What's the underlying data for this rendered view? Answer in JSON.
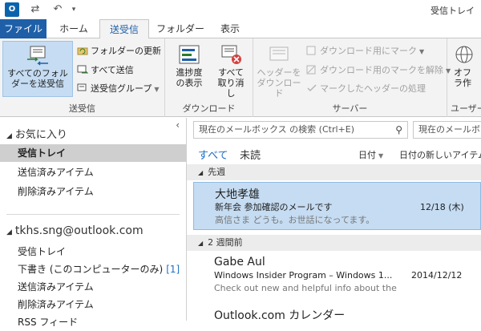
{
  "window": {
    "title": "受信トレイ"
  },
  "tabs": [
    "ファイル",
    "ホーム",
    "送受信",
    "フォルダー",
    "表示"
  ],
  "ribbon": {
    "send_all": "すべてのフォルダーを送受信",
    "update_folder": "フォルダーの更新",
    "send_all_small": "すべて送信",
    "send_receive_groups": "送受信グループ",
    "group_send_receive": "送受信",
    "show_progress": "進捗度の表示",
    "cancel_all": "すべて取り消し",
    "group_download": "ダウンロード",
    "download_headers": "ヘッダーをダウンロード",
    "mark_download": "ダウンロード用にマーク",
    "unmark_download": "ダウンロード用のマークを解除",
    "process_marked": "マークしたヘッダーの処理",
    "group_server": "サーバー",
    "offline_work": "オフラ作",
    "group_user": "ユーザー"
  },
  "folders": {
    "favorites_title": "お気に入り",
    "favorites": [
      "受信トレイ",
      "送信済みアイテム",
      "削除済みアイテム"
    ],
    "account": "tkhs.sng@outlook.com",
    "account_items": [
      "受信トレイ",
      "下書き (このコンピューターのみ)",
      "送信済みアイテム",
      "削除済みアイテム",
      "RSS フィード"
    ],
    "draft_count": "[1]"
  },
  "mail": {
    "search_placeholder": "現在のメールボックス の検索 (Ctrl+E)",
    "search_scope": "現在のメールボックス",
    "filter_all": "すべて",
    "filter_unread": "未読",
    "sort_by": "日付",
    "sort_order": "日付の新しいアイテム",
    "groups": [
      "先週",
      "2 週間前"
    ],
    "messages": [
      {
        "from": "大地孝雄",
        "subject": "新年会 参加確認のメールです",
        "date": "12/18 (木)",
        "preview": "高信さま どうも。お世話になってます。"
      },
      {
        "from": "Gabe Aul",
        "subject": "Windows Insider Program – Windows 1...",
        "date": "2014/12/12",
        "preview": "Check out new and helpful info about the"
      },
      {
        "from": "Outlook.com カレンダー",
        "subject": "",
        "date": "",
        "preview": ""
      }
    ]
  }
}
